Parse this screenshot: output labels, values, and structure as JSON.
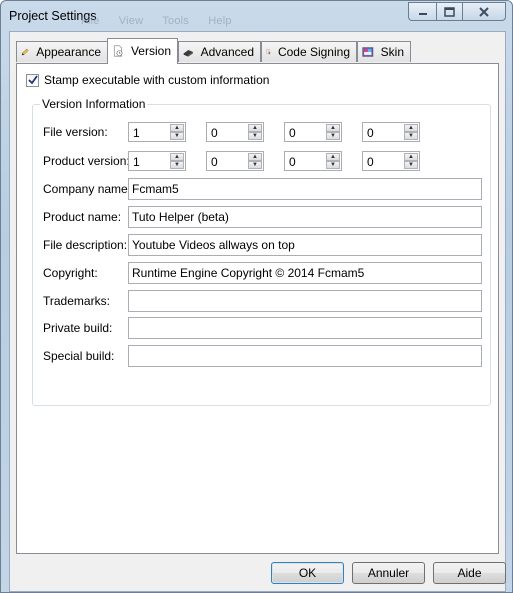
{
  "window": {
    "title": "Project Settings",
    "ghost_menu": [
      "File",
      "View",
      "Tools",
      "Help"
    ]
  },
  "tabs": [
    {
      "label": "Appearance",
      "icon": "pencil-icon"
    },
    {
      "label": "Version",
      "icon": "document-clock-icon",
      "active": true
    },
    {
      "label": "Advanced",
      "icon": "chip-icon"
    },
    {
      "label": "Code Signing",
      "icon": "certificate-icon"
    },
    {
      "label": "Skin",
      "icon": "palette-icon"
    }
  ],
  "stamp": {
    "label": "Stamp executable with custom information",
    "checked": true
  },
  "group": {
    "title": "Version Information"
  },
  "file_version": {
    "label": "File version:",
    "parts": [
      "1",
      "0",
      "0",
      "0"
    ]
  },
  "product_version": {
    "label": "Product version:",
    "parts": [
      "1",
      "0",
      "0",
      "0"
    ]
  },
  "fields": {
    "company_name": {
      "label": "Company name:",
      "value": "Fcmam5"
    },
    "product_name": {
      "label": "Product name:",
      "value": "Tuto Helper (beta)"
    },
    "file_description": {
      "label": "File description:",
      "value": "Youtube Videos allways on top"
    },
    "copyright": {
      "label": "Copyright:",
      "value": "Runtime Engine Copyright © 2014 Fcmam5"
    },
    "trademarks": {
      "label": "Trademarks:",
      "value": ""
    },
    "private_build": {
      "label": "Private build:",
      "value": ""
    },
    "special_build": {
      "label": "Special build:",
      "value": ""
    }
  },
  "buttons": {
    "ok": "OK",
    "cancel": "Annuler",
    "help": "Aide"
  }
}
